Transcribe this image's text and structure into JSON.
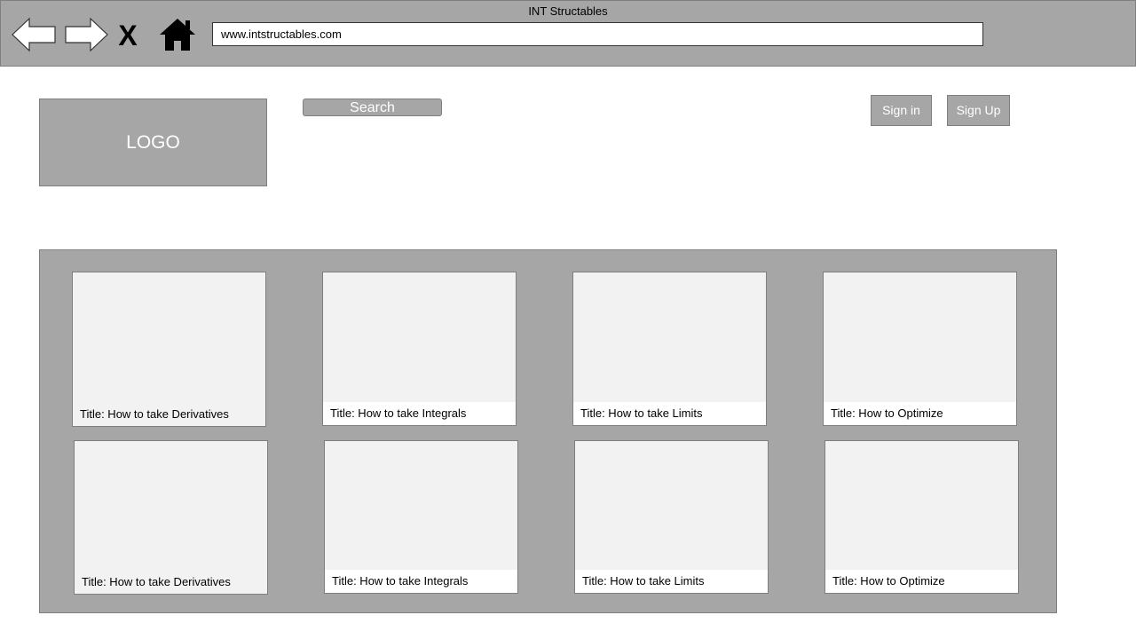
{
  "window": {
    "title": "INT Structables"
  },
  "toolbar": {
    "back_icon": "left-arrow-icon",
    "forward_icon": "right-arrow-icon",
    "close_label": "X",
    "home_icon": "home-icon",
    "url": "www.intstructables.com"
  },
  "header": {
    "logo_label": "LOGO",
    "search_label": "Search",
    "signin_label": "Sign in",
    "signup_label": "Sign Up"
  },
  "cards": [
    {
      "title": "Title: How to take Derivatives"
    },
    {
      "title": "Title: How to take Integrals"
    },
    {
      "title": "Title: How to take Limits"
    },
    {
      "title": "Title: How to Optimize"
    },
    {
      "title": "Title: How to take Derivatives"
    },
    {
      "title": "Title: How to take Integrals"
    },
    {
      "title": "Title: How to take Limits"
    },
    {
      "title": "Title: How to Optimize"
    }
  ],
  "colors": {
    "panel": "#a6a6a6",
    "card": "#f2f2f2",
    "border": "#7f7f7f"
  }
}
